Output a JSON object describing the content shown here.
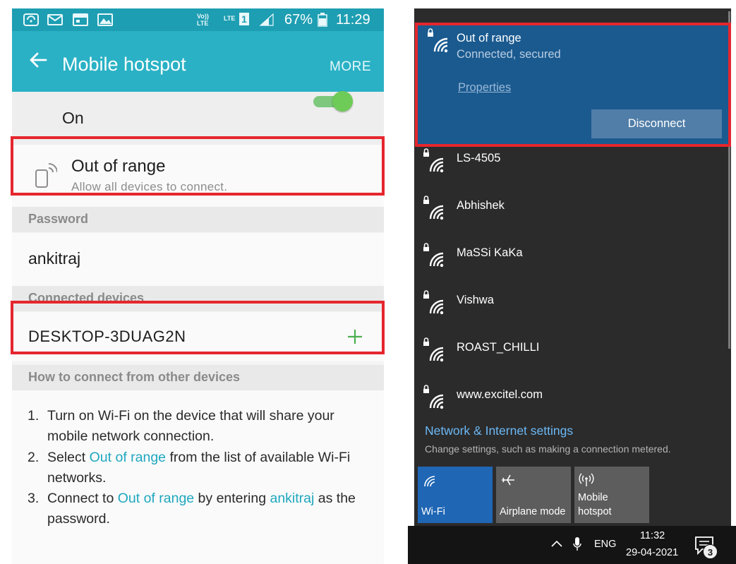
{
  "android": {
    "status_bar": {
      "volte": "Vo))\nLTE",
      "lte_sim": "LTE",
      "sim_slot": "1",
      "battery_pct": "67%",
      "time": "11:29"
    },
    "app_bar": {
      "title": "Mobile hotspot",
      "more": "MORE"
    },
    "toggle_label": "On",
    "toggle_on": true,
    "hotspot": {
      "name": "Out of range",
      "description": "Allow all devices to connect."
    },
    "password_header": "Password",
    "password": "ankitraj",
    "connected_header": "Connected devices",
    "connected_devices": [
      "DESKTOP-3DUAG2N"
    ],
    "howto_header": "How to connect from other devices",
    "steps": [
      {
        "num": "1.",
        "parts": [
          "Turn on Wi-Fi on the device that will share your mobile network connection."
        ]
      },
      {
        "num": "2.",
        "pre": "Select ",
        "hl": "Out of range",
        "post": " from the list of available Wi-Fi networks."
      },
      {
        "num": "3.",
        "pre": "Connect to ",
        "hl": "Out of range",
        "mid": " by entering ",
        "hl2": "ankitraj",
        "post": " as the password."
      }
    ]
  },
  "windows": {
    "active_network": {
      "name": "Out of range",
      "status": "Connected, secured",
      "properties": "Properties",
      "disconnect": "Disconnect"
    },
    "networks": [
      "LS-4505",
      "Abhishek",
      "MaSSi KaKa",
      "Vishwa",
      "ROAST_CHILLI",
      "www.excitel.com"
    ],
    "settings_link": "Network & Internet settings",
    "settings_sub": "Change settings, such as making a connection metered.",
    "tiles": [
      {
        "label": "Wi-Fi",
        "icon": "wifi-icon",
        "active": true
      },
      {
        "label": "Airplane mode",
        "icon": "airplane-icon",
        "active": false
      },
      {
        "label": "Mobile\nhotspot",
        "icon": "hotspot-icon",
        "active": false
      }
    ],
    "taskbar": {
      "language": "ENG",
      "time": "11:32",
      "date": "29-04-2021",
      "notification_count": "3"
    }
  },
  "colors": {
    "android_appbar": "#2ab1c5",
    "android_statusbar": "#1e9eb2",
    "highlight_box": "#e5262d",
    "android_link": "#1fa7bf",
    "win_active": "#1a5a8f",
    "win_tile_on": "#1f66b5"
  }
}
